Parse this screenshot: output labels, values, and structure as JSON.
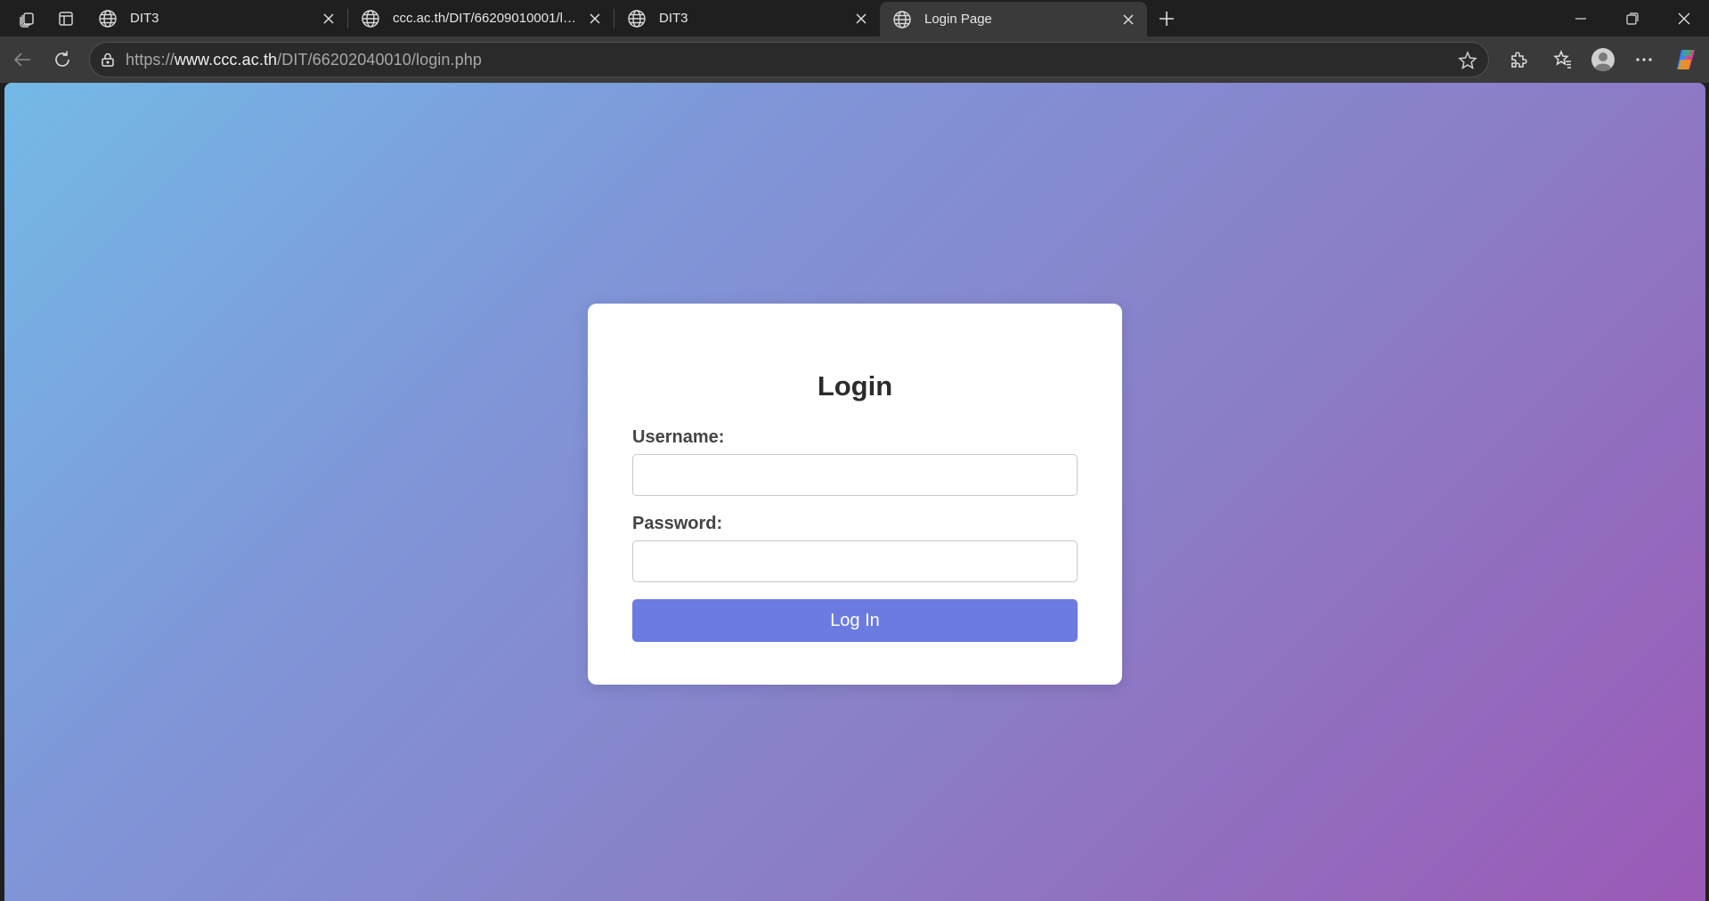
{
  "browser": {
    "tabs": [
      {
        "title": "DIT3",
        "active": false
      },
      {
        "title": "ccc.ac.th/DIT/66209010001/login.php",
        "active": false
      },
      {
        "title": "DIT3",
        "active": false
      },
      {
        "title": "Login Page",
        "active": true
      }
    ],
    "address": {
      "scheme": "https://",
      "host": "www.ccc.ac.th",
      "path": "/DIT/66202040010/login.php"
    },
    "icons": {
      "workspaces": "workspaces-icon",
      "tab_actions": "tab-actions-icon",
      "new_tab": "plus-icon",
      "minimize": "minimize-icon",
      "restore": "restore-icon",
      "close": "close-icon",
      "back": "back-arrow-icon",
      "refresh": "refresh-icon",
      "lock": "lock-icon",
      "favorite": "star-icon",
      "extensions": "puzzle-icon",
      "favorites": "favorites-icon",
      "profile": "profile-icon",
      "menu": "more-icon",
      "copilot": "copilot-icon"
    }
  },
  "page": {
    "title": "Login",
    "username_label": "Username:",
    "username_value": "",
    "password_label": "Password:",
    "password_value": "",
    "submit_label": "Log In",
    "colors": {
      "gradient_start": "#74b9e7",
      "gradient_end": "#9b59b6",
      "button": "#6c7be0"
    }
  }
}
